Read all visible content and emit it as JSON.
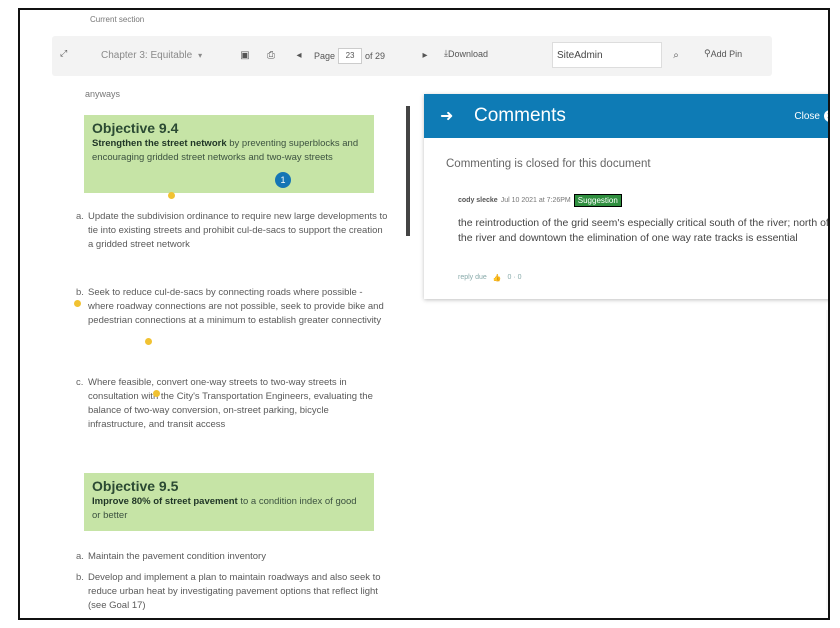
{
  "section_label": "Current section",
  "toolbar": {
    "chapter": "Chapter 3: Equitable",
    "page_prefix": "Page",
    "page_current": "23",
    "page_total": "of 29",
    "download": "Download",
    "search_value": "SiteAdmin",
    "add_pin": "Add Pin"
  },
  "doc": {
    "prev_text": "anyways",
    "objective_94": {
      "title": "Objective 9.4",
      "bold": "Strengthen the street network",
      "rest": " by preventing superblocks and encouraging gridded street networks and two-way streets"
    },
    "items_94": [
      {
        "marker": "a.",
        "text": "Update the subdivision ordinance to require new large developments to tie into existing streets and prohibit cul-de-sacs to support the creation a gridded street network"
      },
      {
        "marker": "b.",
        "text": "Seek to reduce cul-de-sacs by connecting roads where possible - where roadway connections are not possible, seek to provide bike and pedestrian connections at a minimum to establish greater connectivity"
      },
      {
        "marker": "c.",
        "text": "Where feasible, convert one-way streets to two-way streets in consultation with the City's Transportation Engineers, evaluating the balance of two-way conversion, on-street parking, bicycle infrastructure, and transit access"
      }
    ],
    "objective_95": {
      "title": "Objective 9.5",
      "bold": "Improve 80% of street pavement",
      "rest": " to a condition index of good or better"
    },
    "items_95": [
      {
        "marker": "a.",
        "text": "Maintain the pavement condition inventory"
      },
      {
        "marker": "b.",
        "text": "Develop and implement a plan to maintain roadways and also seek to reduce urban heat by investigating pavement options that reflect light (see Goal 17)"
      }
    ],
    "bubble_count": "1"
  },
  "comments": {
    "title": "Comments",
    "close_label": "Close",
    "closed_message": "Commenting is closed for this document",
    "author": "cody slecke",
    "date": "Jul 10 2021 at 7:26PM",
    "tag": "Suggestion",
    "body": "the reintroduction of the grid seem's especially critical south of the river; north of the river and downtown the elimination of one way rate tracks is essential",
    "action_reply": "reply due",
    "action_votes": "0 · 0"
  }
}
